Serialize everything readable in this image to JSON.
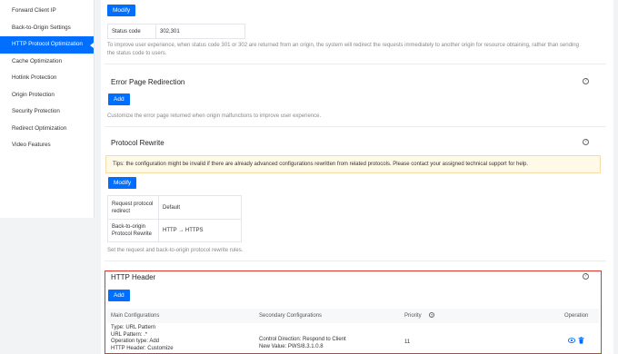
{
  "sidebar": {
    "items": [
      {
        "label": "Forward Client IP"
      },
      {
        "label": "Back-to-Origin Settings"
      },
      {
        "label": "HTTP Protocol Optimization"
      },
      {
        "label": "Cache Optimization"
      },
      {
        "label": "Hotlink Protection"
      },
      {
        "label": "Origin Protection"
      },
      {
        "label": "Security Protection"
      },
      {
        "label": "Redirect Optimization"
      },
      {
        "label": "Video Features"
      }
    ]
  },
  "status_code": {
    "modify_label": "Modify",
    "label": "Status code",
    "value": "302,301",
    "description_1": "To improve user experience, when status code 301 or 302 are returned from an origin, the system will redirect the requests immediately to another origin for resource obtaining, rather than sending",
    "description_2": "the status code to users."
  },
  "error_page": {
    "title": "Error Page Redirection",
    "add_label": "Add",
    "description": "Customize the error page returned when origin malfunctions to improve user experience."
  },
  "protocol_rewrite": {
    "title": "Protocol Rewrite",
    "tip": "Tips: the configuration might be invalid if there are already advanced configurations rewritten from related protocols. Please contact your assigned technical support for help.",
    "modify_label": "Modify",
    "row1_label_1": "Request protocol",
    "row1_label_2": "redirect",
    "row1_value": "Default",
    "row2_label_1": "Back-to-origin",
    "row2_label_2": "Protocol Rewrite",
    "row2_value": "HTTP → HTTPS",
    "description": "Set the request and back-to-origin protocol rewrite rules."
  },
  "http_header": {
    "title": "HTTP Header",
    "add_label": "Add",
    "columns": {
      "main": "Main Configurations",
      "secondary": "Secondary Configurations",
      "priority": "Priority",
      "operation": "Operation"
    },
    "row": {
      "main_1": "Type: URL Pattern",
      "main_2": "URL Pattern: .*",
      "main_3": "Operation type: Add",
      "main_4": "HTTP Header: Customize",
      "secondary_1": "Control Direction: Respond to Client",
      "secondary_2": "New Value: PWS/8.3.1.0.8",
      "priority": "11"
    }
  },
  "help_glyph": "?",
  "colors": {
    "accent": "#006eff",
    "highlight_border": "#e0362a"
  }
}
